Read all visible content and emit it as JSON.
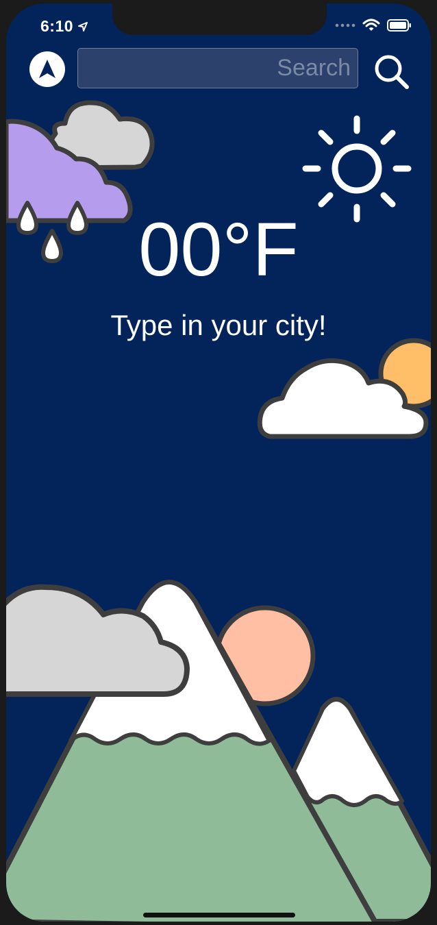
{
  "status_bar": {
    "time": "6:10",
    "icons": [
      "location-arrow-icon",
      "signal-dots-icon",
      "wifi-icon",
      "battery-icon"
    ]
  },
  "search": {
    "placeholder": "Search",
    "value": ""
  },
  "weather": {
    "temperature": "00",
    "unit": "°F",
    "prompt": "Type in your city!"
  },
  "colors": {
    "background": "#03245a",
    "outline": "#3e3e3e",
    "rain_cloud": "#b69cec",
    "grey_cloud": "#d6d6d6",
    "sun_orange": "#ffbe67",
    "peach_sun": "#ffbfa4",
    "mountain_green": "#8fbb98"
  }
}
